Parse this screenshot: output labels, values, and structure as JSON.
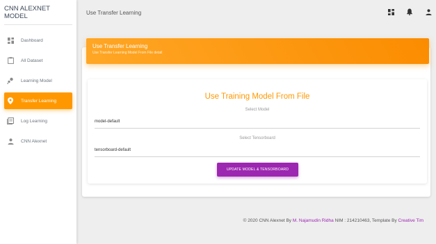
{
  "app": {
    "brand": "CNN ALEXNET MODEL",
    "page_title": "Use Transfer Learning"
  },
  "sidebar": {
    "items": [
      {
        "label": "Dashboard",
        "icon": "dashboard-icon",
        "active": false
      },
      {
        "label": "All Dataset",
        "icon": "clipboard-icon",
        "active": false
      },
      {
        "label": "Learning Model",
        "icon": "bubbles-icon",
        "active": false
      },
      {
        "label": "Transfer Learning",
        "icon": "location-pin-icon",
        "active": true
      },
      {
        "label": "Log Learning",
        "icon": "log-icon",
        "active": false
      },
      {
        "label": "CNN Alexnet",
        "icon": "person-icon",
        "active": false
      }
    ]
  },
  "topbar": {
    "icons": [
      "dashboard-icon",
      "notifications-icon",
      "person-icon"
    ]
  },
  "card": {
    "title": "Use Transfer Learning",
    "subtitle": "Use Transfer Learning Model From File detail",
    "inner_title": "Use Training Model From File",
    "model_label": "Select Model",
    "model_value": "model-default",
    "tensorboard_label": "Select Tensorboard",
    "tensorboard_value": "tensorboard-default",
    "button_label": "UPDATE MODEL & TENSORBOARD"
  },
  "footer": {
    "prefix": "© 2020 CNN Alexnet By ",
    "author": "M. Najamudin Ridha",
    "middle": " NIM : 214210463, Template By ",
    "template": "Creative Tim"
  },
  "colors": {
    "accent": "#ff9800",
    "button": "#9c27b0"
  }
}
